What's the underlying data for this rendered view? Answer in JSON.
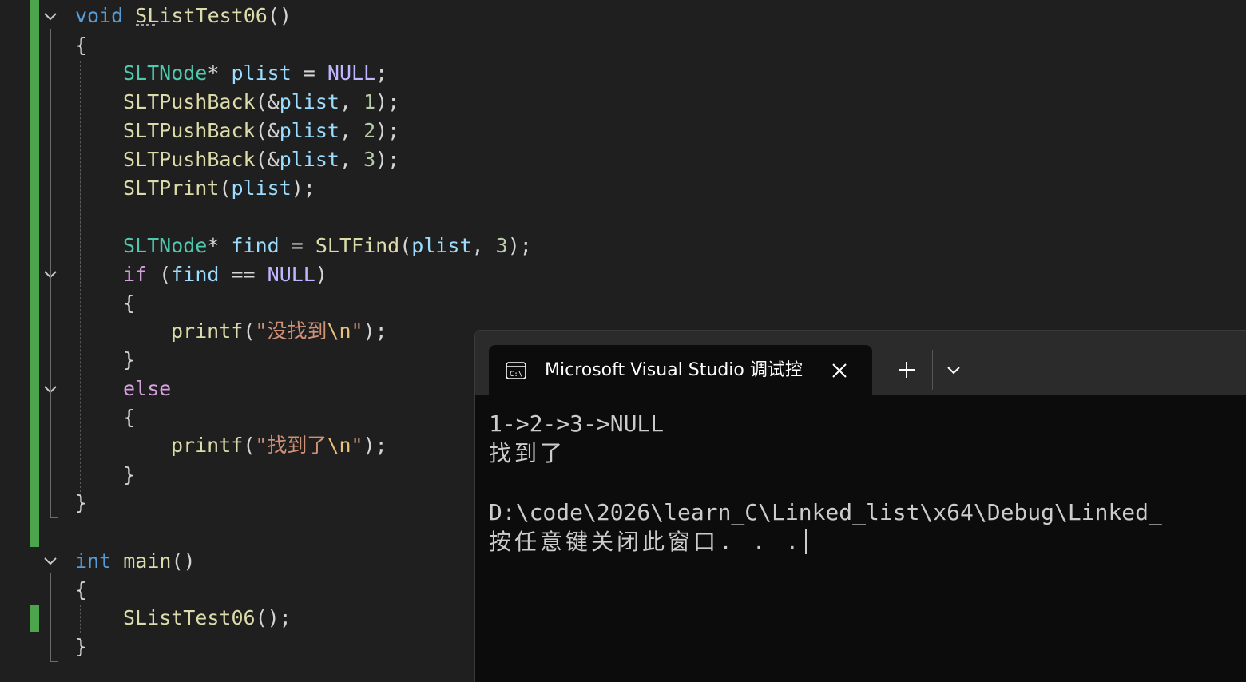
{
  "editor": {
    "lines": [
      [
        "void",
        " ",
        "SListTest06",
        "()"
      ],
      [
        "{"
      ],
      [
        "SLTNode",
        "*",
        " ",
        "plist",
        " = ",
        "NULL",
        ";"
      ],
      [
        "SLTPushBack",
        "(&",
        "plist",
        ", ",
        "1",
        ");"
      ],
      [
        "SLTPushBack",
        "(&",
        "plist",
        ", ",
        "2",
        ");"
      ],
      [
        "SLTPushBack",
        "(&",
        "plist",
        ", ",
        "3",
        ");"
      ],
      [
        "SLTPrint",
        "(",
        "plist",
        ");"
      ],
      [],
      [
        "SLTNode",
        "*",
        " ",
        "find",
        " = ",
        "SLTFind",
        "(",
        "plist",
        ", ",
        "3",
        ");"
      ],
      [
        "if",
        " (",
        "find",
        " == ",
        "NULL",
        ")"
      ],
      [
        "{"
      ],
      [
        "printf",
        "(",
        "\"没找到",
        "\\n",
        "\"",
        ");"
      ],
      [
        "}"
      ],
      [
        "else"
      ],
      [
        "{"
      ],
      [
        "printf",
        "(",
        "\"找到了",
        "\\n",
        "\"",
        ");"
      ],
      [
        "}"
      ],
      [
        "}"
      ],
      [],
      [
        "int",
        " ",
        "main",
        "()"
      ],
      [
        "{"
      ],
      [
        "SListTest06",
        "();"
      ],
      [
        "}"
      ]
    ]
  },
  "terminal": {
    "tab_title": "Microsoft Visual Studio 调试控",
    "icons": {
      "tab": "terminal-icon",
      "close": "close-icon",
      "new_tab": "plus-icon",
      "dropdown": "chevron-down-icon"
    },
    "output": [
      "1->2->3->NULL",
      "找到了",
      "",
      "D:\\code\\2026\\learn_C\\Linked_list\\x64\\Debug\\Linked_",
      "按任意键关闭此窗口. . ."
    ]
  },
  "colors": {
    "editor_bg": "#1f1f1f",
    "change_bar": "#4ca54c",
    "terminal_bg": "#0c0c0c",
    "terminal_titlebar": "#2b2b2b",
    "terminal_text": "#cccccc"
  }
}
